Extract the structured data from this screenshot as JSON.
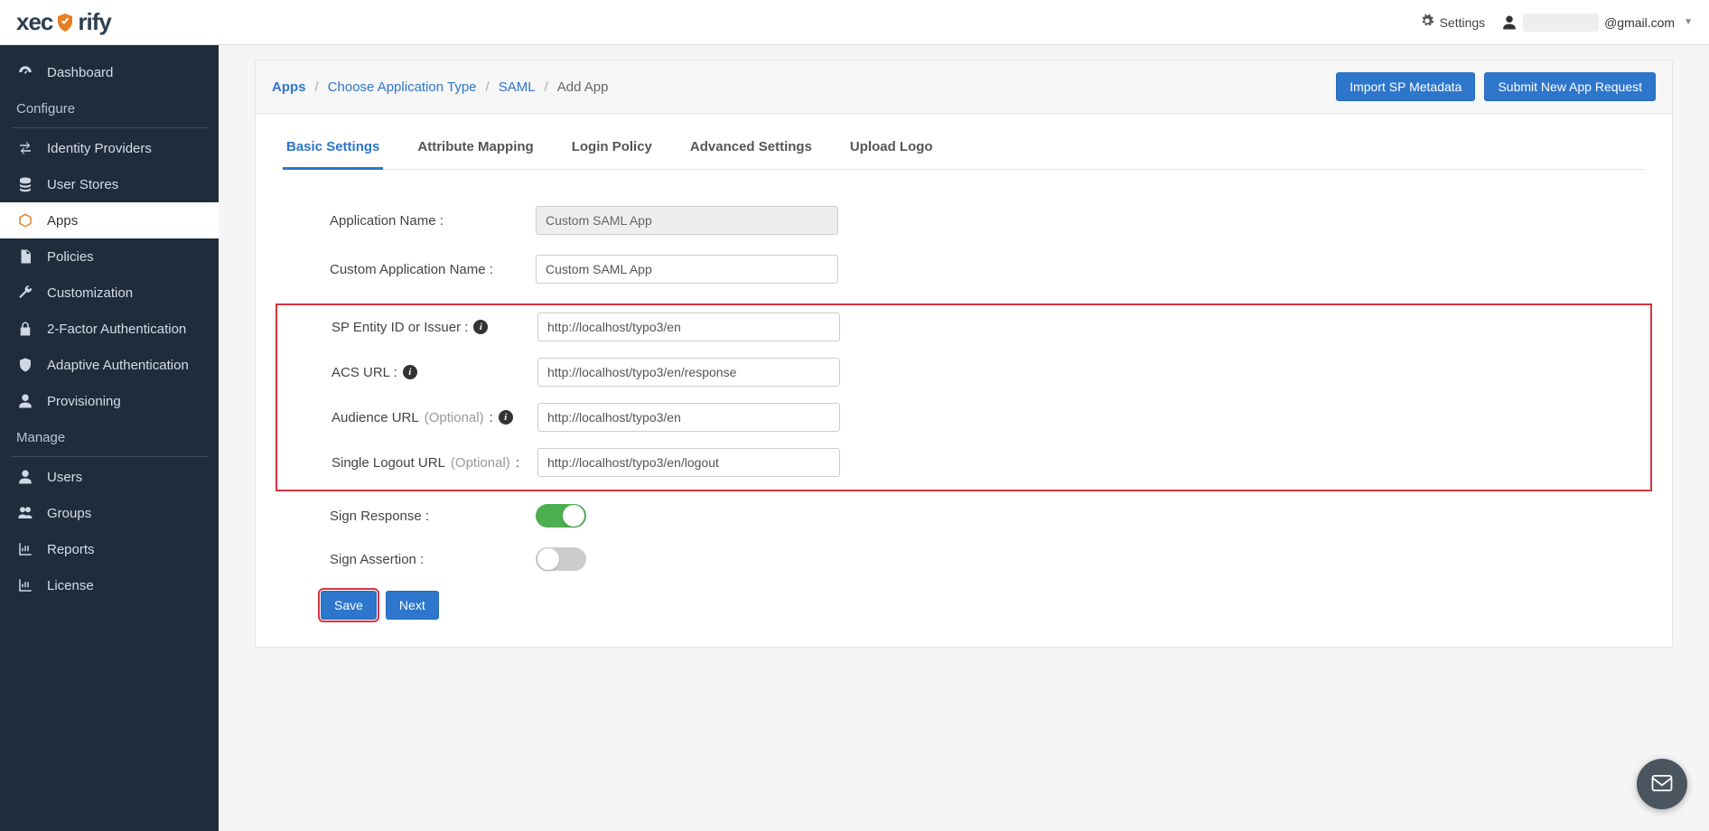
{
  "header": {
    "logo_prefix": "xec",
    "logo_suffix": "rify",
    "settings_label": "Settings",
    "user_email_suffix": "@gmail.com"
  },
  "sidebar": {
    "items_top": [
      {
        "icon": "dashboard",
        "label": "Dashboard"
      }
    ],
    "section_configure": "Configure",
    "items_configure": [
      {
        "icon": "exchange",
        "label": "Identity Providers"
      },
      {
        "icon": "database",
        "label": "User Stores"
      },
      {
        "icon": "cube",
        "label": "Apps",
        "active": true
      },
      {
        "icon": "file",
        "label": "Policies"
      },
      {
        "icon": "wrench",
        "label": "Customization"
      },
      {
        "icon": "lock",
        "label": "2-Factor Authentication"
      },
      {
        "icon": "shield",
        "label": "Adaptive Authentication"
      },
      {
        "icon": "user",
        "label": "Provisioning"
      }
    ],
    "section_manage": "Manage",
    "items_manage": [
      {
        "icon": "user",
        "label": "Users"
      },
      {
        "icon": "users",
        "label": "Groups"
      },
      {
        "icon": "chart",
        "label": "Reports"
      },
      {
        "icon": "chart",
        "label": "License"
      }
    ]
  },
  "breadcrumb": {
    "apps": "Apps",
    "choose_type": "Choose Application Type",
    "saml": "SAML",
    "current": "Add App"
  },
  "header_actions": {
    "import": "Import SP Metadata",
    "submit": "Submit New App Request"
  },
  "tabs": [
    {
      "label": "Basic Settings",
      "active": true
    },
    {
      "label": "Attribute Mapping"
    },
    {
      "label": "Login Policy"
    },
    {
      "label": "Advanced Settings"
    },
    {
      "label": "Upload Logo"
    }
  ],
  "form": {
    "app_name_label": "Application Name :",
    "app_name_value": "Custom SAML App",
    "custom_app_name_label": "Custom Application Name :",
    "custom_app_name_value": "Custom SAML App",
    "sp_entity_label": "SP Entity ID or Issuer :",
    "sp_entity_value": "http://localhost/typo3/en",
    "acs_url_label": "ACS URL :",
    "acs_url_value": "http://localhost/typo3/en/response",
    "audience_url_label": "Audience URL",
    "audience_url_optional": "(Optional)",
    "audience_url_colon": " :",
    "audience_url_value": "http://localhost/typo3/en",
    "slo_url_label": "Single Logout URL",
    "slo_url_optional": "(Optional)",
    "slo_url_colon": " :",
    "slo_url_value": "http://localhost/typo3/en/logout",
    "sign_response_label": "Sign Response :",
    "sign_response_on": true,
    "sign_assertion_label": "Sign Assertion :",
    "sign_assertion_on": false
  },
  "footer": {
    "save": "Save",
    "next": "Next"
  }
}
